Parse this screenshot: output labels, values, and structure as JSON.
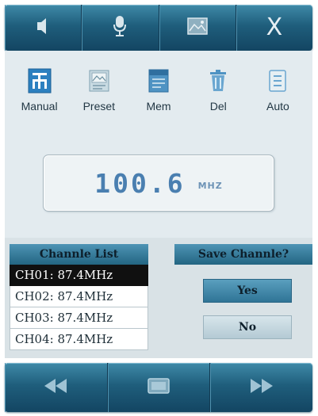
{
  "top_bar": {
    "buttons": [
      {
        "icon": "speaker-icon"
      },
      {
        "icon": "microphone-icon"
      },
      {
        "icon": "picture-icon"
      },
      {
        "icon": "close-icon",
        "label": "X"
      }
    ]
  },
  "modes": [
    {
      "label": "Manual",
      "icon": "manual-icon",
      "active": true
    },
    {
      "label": "Preset",
      "icon": "preset-icon"
    },
    {
      "label": "Mem",
      "icon": "memory-icon"
    },
    {
      "label": "Del",
      "icon": "trash-icon"
    },
    {
      "label": "Auto",
      "icon": "auto-scan-icon"
    }
  ],
  "frequency": {
    "value": "100.6",
    "unit": "MHZ"
  },
  "channel_list": {
    "title": "Channle List",
    "items": [
      {
        "label": "CH01: 87.4MHz",
        "selected": true
      },
      {
        "label": "CH02: 87.4MHz"
      },
      {
        "label": "CH03: 87.4MHz"
      },
      {
        "label": "CH04: 87.4MHz"
      }
    ]
  },
  "save_dialog": {
    "title": "Save Channle?",
    "yes_label": "Yes",
    "no_label": "No"
  },
  "bottom_bar": {
    "buttons": [
      {
        "icon": "rewind-icon"
      },
      {
        "icon": "stop-icon"
      },
      {
        "icon": "fast-forward-icon"
      }
    ]
  },
  "colors": {
    "bar_blue": "#1f5e7c",
    "screen_bg": "#e3ebef",
    "accent_blue": "#4a7fb0",
    "selected_row": "#101010"
  }
}
